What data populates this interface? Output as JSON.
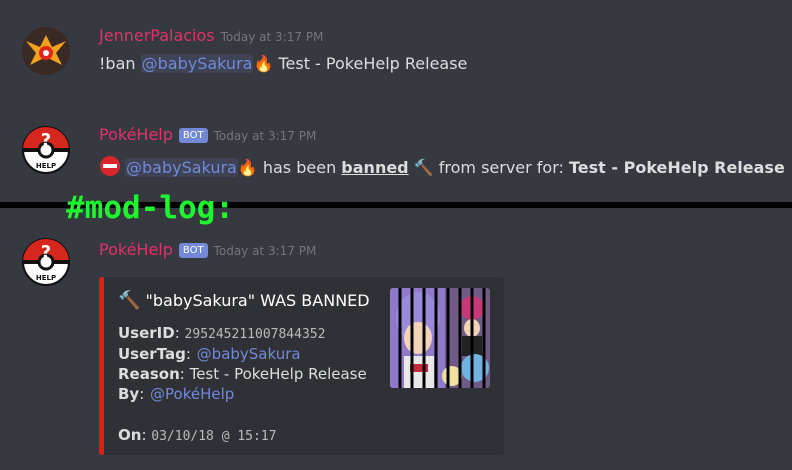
{
  "messages": [
    {
      "author": "JennerPalacios",
      "author_color": "#e0316b",
      "timestamp": "Today at 3:17 PM",
      "text_prefix": "!ban ",
      "mention": "@babySakura",
      "text_suffix": " Test - PokeHelp Release"
    },
    {
      "author": "PokéHelp",
      "author_color": "#e0316b",
      "bot_tag": "BOT",
      "timestamp": "Today at 3:17 PM",
      "mention": "@babySakura",
      "text_1": " has been ",
      "banned_word": "banned",
      "text_2": " from server for: ",
      "reason": "Test - PokeHelp Release"
    }
  ],
  "channel_label": "#mod-log:",
  "log_message": {
    "author": "PokéHelp",
    "bot_tag": "BOT",
    "timestamp": "Today at 3:17 PM",
    "embed": {
      "title": "\"babySakura\" WAS BANNED",
      "accent_color": "#e91916",
      "fields": {
        "userid_label": "UserID",
        "userid_value": "295245211007844352",
        "usertag_label": "UserTag",
        "usertag_value": "@babySakura",
        "reason_label": "Reason",
        "reason_value": "Test - PokeHelp Release",
        "by_label": "By",
        "by_value": "@PokéHelp",
        "on_label": "On",
        "on_value": "03/10/18 @ 15:17"
      }
    }
  },
  "icons": [
    "team-valor-avatar-icon",
    "pokehelp-pokeball-avatar-icon",
    "no-entry-icon",
    "fire-icon",
    "hammer-icon"
  ]
}
